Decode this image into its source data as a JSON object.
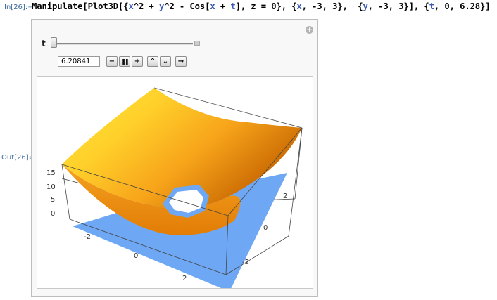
{
  "cell": {
    "in_label": "In[26]:=",
    "out_label": "Out[26]=",
    "code_prefix": "Manipulate[Plot3D[{",
    "code_x": "x",
    "code_mid1": "^2 + ",
    "code_y": "y",
    "code_mid2": "^2 - Cos[",
    "code_x2": "x",
    "code_plus": " + ",
    "code_t": "t",
    "code_mid3": "], z = 0}, {",
    "code_x3": "x",
    "code_mid4": ", -3, 3},  {",
    "code_y2": "y",
    "code_mid5": ", -3, 3}], {",
    "code_t2": "t",
    "code_suffix": ", 0, 6.28}]"
  },
  "controls": {
    "variable_label": "t",
    "slider": {
      "min": 0,
      "max": 6.28,
      "value": 6.20841
    },
    "value_text": "6.20841",
    "buttons": {
      "step_back": "−",
      "pause": "❚❚",
      "step_forward": "+",
      "faster": "⌃",
      "slower": "⌄",
      "direction": "→"
    },
    "options_icon": "plus-circle-icon"
  },
  "plot": {
    "z_ticks": [
      "15",
      "10",
      "5",
      "0"
    ],
    "x_ticks": [
      "-2",
      "0",
      "2"
    ],
    "y_ticks": [
      "2",
      "0",
      "-2"
    ],
    "colors": {
      "surface_light": "#ffe23a",
      "surface_mid": "#f7a41a",
      "surface_dark": "#c46200",
      "plane": "#6fa8f2"
    }
  }
}
